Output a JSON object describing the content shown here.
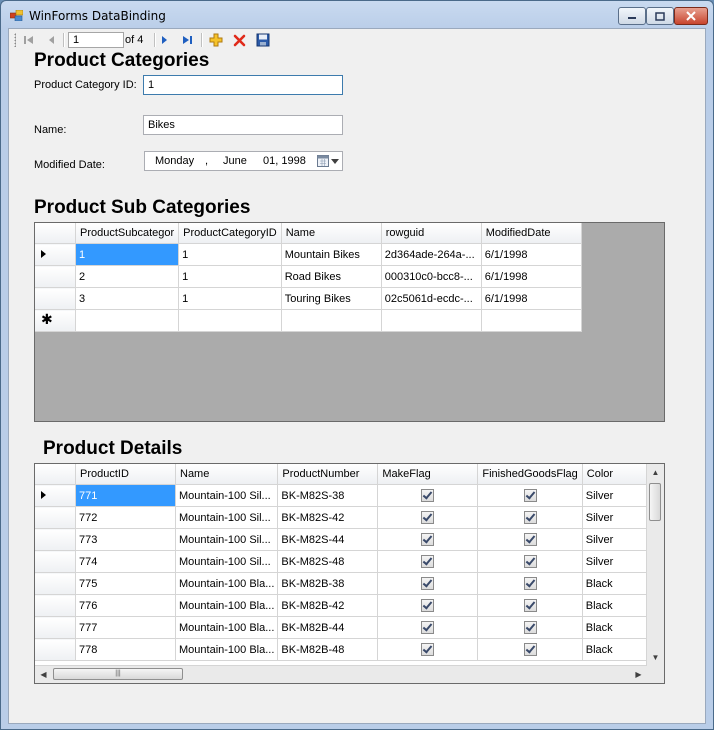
{
  "window": {
    "title": "WinForms DataBinding"
  },
  "navigator": {
    "position": "1",
    "count_label": "of 4"
  },
  "categories": {
    "heading": "Product Categories",
    "id_label": "Product Category ID:",
    "id_value": "1",
    "name_label": "Name:",
    "name_value": "Bikes",
    "modified_label": "Modified Date:",
    "date_day": "Monday",
    "date_sep": ",",
    "date_month": "June",
    "date_rest": "01, 1998"
  },
  "subcategories": {
    "heading": "Product Sub Categories",
    "columns": [
      "ProductSubcategor",
      "ProductCategoryID",
      "Name",
      "rowguid",
      "ModifiedDate"
    ],
    "rows": [
      [
        "1",
        "1",
        "Mountain Bikes",
        "2d364ade-264a-...",
        "6/1/1998"
      ],
      [
        "2",
        "1",
        "Road Bikes",
        "000310c0-bcc8-...",
        "6/1/1998"
      ],
      [
        "3",
        "1",
        "Touring Bikes",
        "02c5061d-ecdc-...",
        "6/1/1998"
      ]
    ]
  },
  "details": {
    "heading": "Product Details",
    "columns": [
      "ProductID",
      "Name",
      "ProductNumber",
      "MakeFlag",
      "FinishedGoodsFlag",
      "Color"
    ],
    "rows": [
      [
        "771",
        "Mountain-100 Sil...",
        "BK-M82S-38",
        true,
        true,
        "Silver"
      ],
      [
        "772",
        "Mountain-100 Sil...",
        "BK-M82S-42",
        true,
        true,
        "Silver"
      ],
      [
        "773",
        "Mountain-100 Sil...",
        "BK-M82S-44",
        true,
        true,
        "Silver"
      ],
      [
        "774",
        "Mountain-100 Sil...",
        "BK-M82S-48",
        true,
        true,
        "Silver"
      ],
      [
        "775",
        "Mountain-100 Bla...",
        "BK-M82B-38",
        true,
        true,
        "Black"
      ],
      [
        "776",
        "Mountain-100 Bla...",
        "BK-M82B-42",
        true,
        true,
        "Black"
      ],
      [
        "777",
        "Mountain-100 Bla...",
        "BK-M82B-44",
        true,
        true,
        "Black"
      ],
      [
        "778",
        "Mountain-100 Bla...",
        "BK-M82B-48",
        true,
        true,
        "Black"
      ]
    ]
  },
  "colors": {
    "selection": "#3399ff",
    "grid_background": "#ababab",
    "close_button": "#c8452e"
  }
}
